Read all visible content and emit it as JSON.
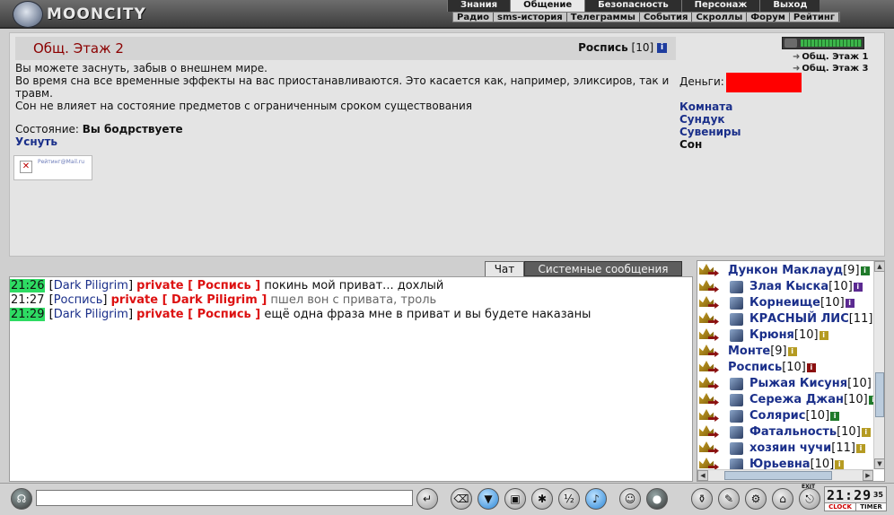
{
  "app": {
    "logo_text": "MOONCITY"
  },
  "nav_primary": [
    "Знания",
    "Общение",
    "Безопасность",
    "Персонаж",
    "Выход"
  ],
  "nav_primary_active": "Общение",
  "nav_secondary": [
    "Радио",
    "sms-история",
    "Телеграммы",
    "События",
    "Скроллы",
    "Форум",
    "Рейтинг"
  ],
  "room": {
    "title": "Общ. Этаж 2",
    "user_name": "Роспись",
    "user_level": "[10]",
    "description": [
      "Вы можете заснуть, забыв о внешнем мире.",
      "Во время сна все временные эффекты на вас приостанавливаются. Это касается как, например, эликсиров, так и травм.",
      "Сон не влияет на состояние предметов с ограниченным сроком существования"
    ],
    "state_label": "Состояние:",
    "state_value": "Вы бодрствуете",
    "sleep_action": "Уснуть",
    "rating_badge_text": "Рейтинг@Mail.ru"
  },
  "right_panel": {
    "floor_links": [
      "Общ. Этаж 1",
      "Общ. Этаж 3"
    ],
    "money_label": "Деньги:",
    "links": [
      "Комната",
      "Сундук",
      "Сувениры",
      "Сон"
    ],
    "active_link": "Сон",
    "money_box_color": "#ff0000"
  },
  "chat_tabs": {
    "chat": "Чат",
    "system": "Системные сообщения"
  },
  "chat_messages": [
    {
      "time": "21:26",
      "time_highlight": true,
      "from": "Dark Piligrim",
      "private_label": "private [ Роспись ]",
      "text": "покинь мой приват... дохлый",
      "grey": false
    },
    {
      "time": "21:27",
      "time_highlight": false,
      "from": "Роспись",
      "private_label": "private [ Dark Piligrim ]",
      "text": "пшел вон с привата, троль",
      "grey": true
    },
    {
      "time": "21:29",
      "time_highlight": true,
      "from": "Dark Piligrim",
      "private_label": "private [ Роспись ]",
      "text": "ещё одна фраза мне в приват и вы будете наказаны",
      "grey": false
    }
  ],
  "users": [
    {
      "name": "Дункон Маклауд",
      "level": "[9]",
      "clan": false,
      "badge_color": "#1f7a2a"
    },
    {
      "name": "Злая Кыска",
      "level": "[10]",
      "clan": true,
      "badge_color": "#5b2a91"
    },
    {
      "name": "Корнеище",
      "level": "[10]",
      "clan": true,
      "badge_color": "#5b2a91"
    },
    {
      "name": "КРАСНЫЙ ЛИС",
      "level": "[11]",
      "clan": true,
      "badge_color": ""
    },
    {
      "name": "Крюня",
      "level": "[10]",
      "clan": true,
      "badge_color": "#b59b22"
    },
    {
      "name": "Монте",
      "level": "[9]",
      "clan": false,
      "badge_color": "#b59b22"
    },
    {
      "name": "Роспись",
      "level": "[10]",
      "clan": false,
      "badge_color": "#8b1010"
    },
    {
      "name": "Рыжая Кисуня",
      "level": "[10]",
      "clan": true,
      "badge_color": ""
    },
    {
      "name": "Сережа Джан",
      "level": "[10]",
      "clan": true,
      "badge_color": "#1f7a2a"
    },
    {
      "name": "Солярис",
      "level": "[10]",
      "clan": true,
      "badge_color": "#1f7a2a"
    },
    {
      "name": "Фатальность",
      "level": "[10]",
      "clan": true,
      "badge_color": "#b59b22"
    },
    {
      "name": "хозяин чучи",
      "level": "[11]",
      "clan": true,
      "badge_color": "#b59b22"
    },
    {
      "name": "Юрьевна",
      "level": "[10]",
      "clan": true,
      "badge_color": "#b59b22"
    }
  ],
  "bottom_bar": {
    "input_value": "",
    "clock_time": "21:29",
    "clock_seconds": "35",
    "clock_label": "CLOCK",
    "timer_label": "TIMER",
    "exit_label": "EXIT"
  }
}
